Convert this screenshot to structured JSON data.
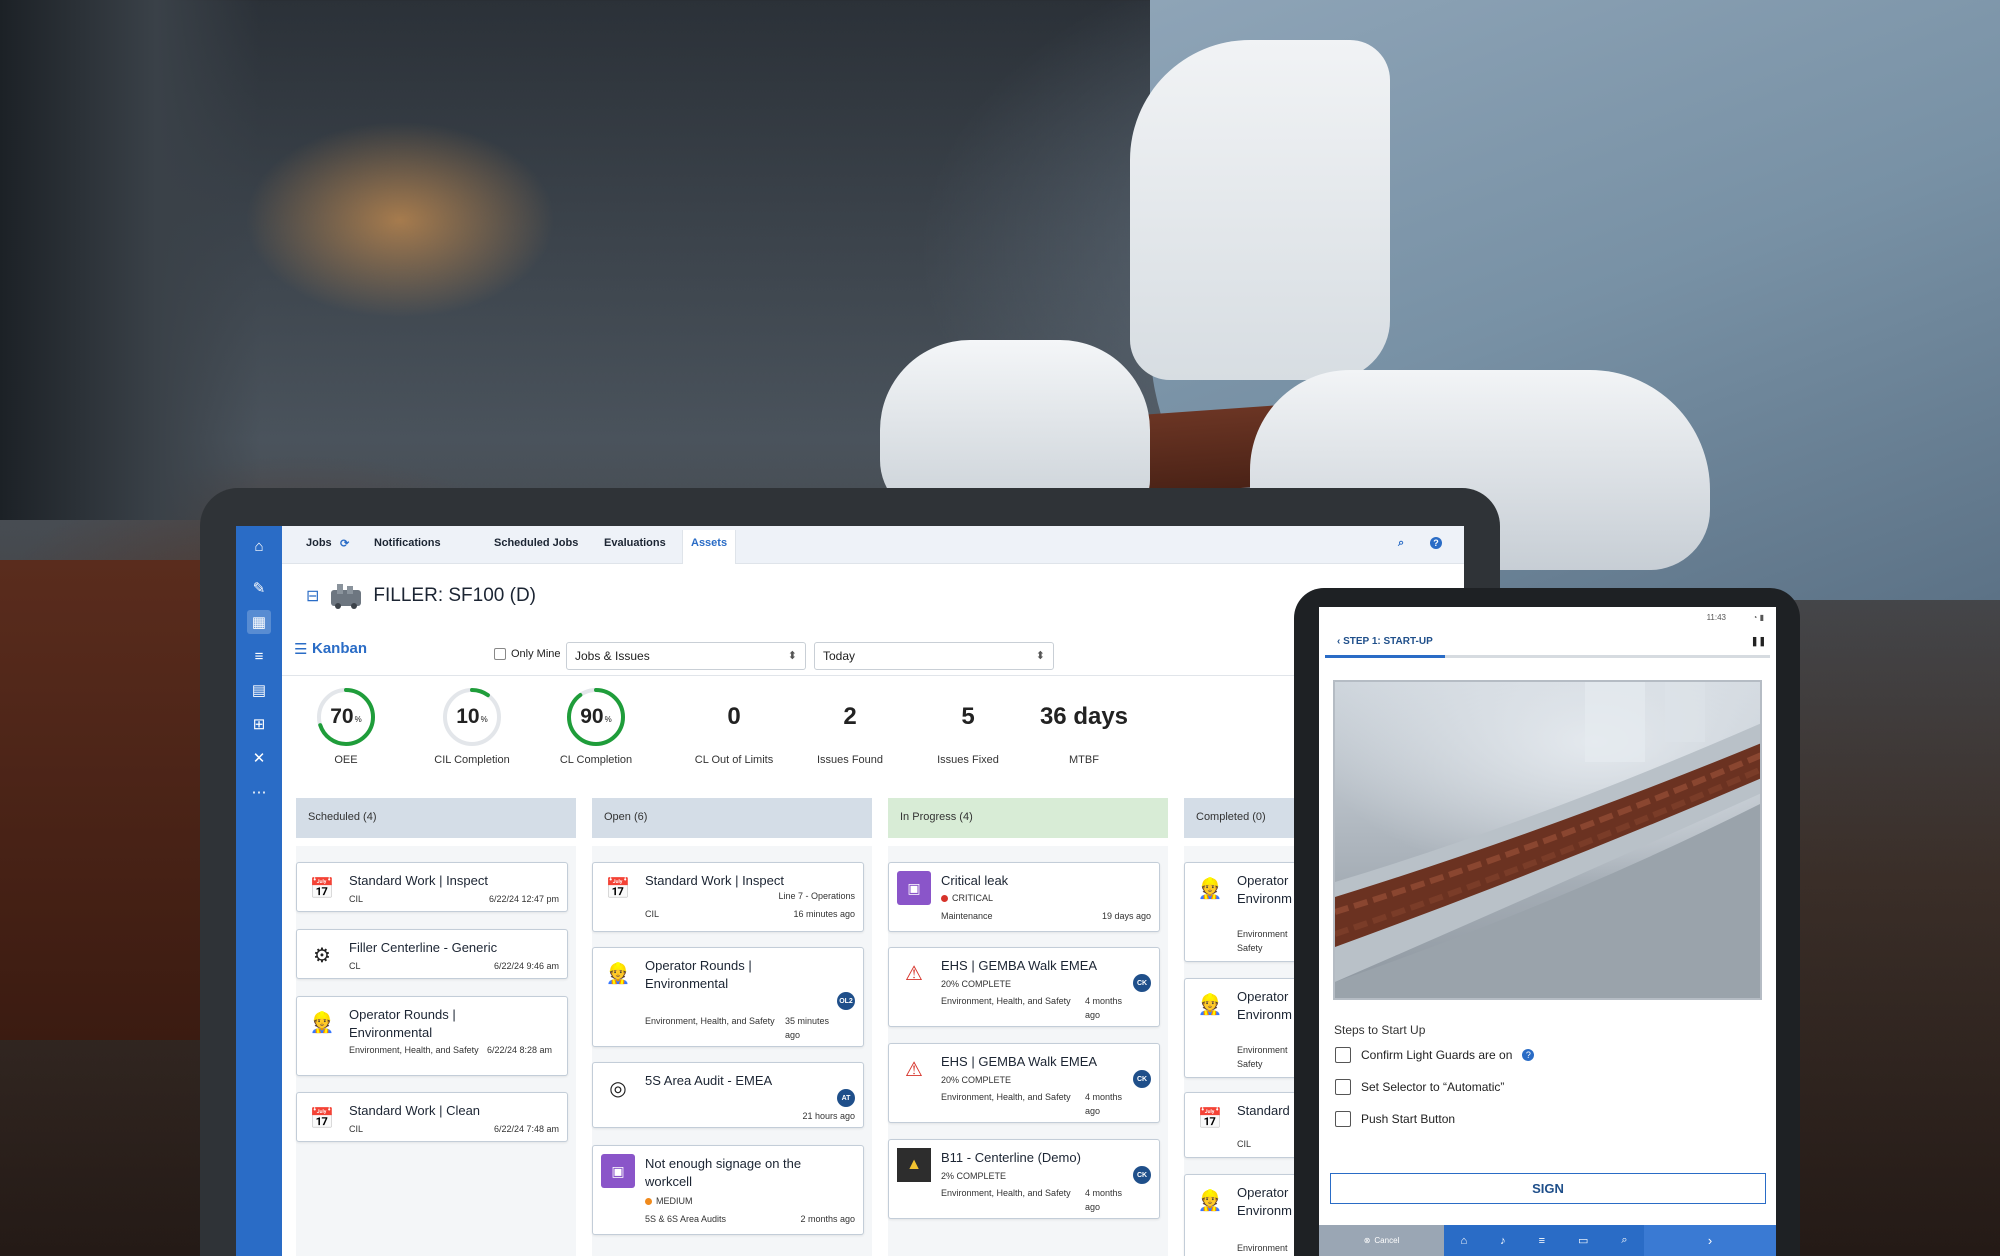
{
  "nav": {
    "tabs": [
      "Jobs",
      "Notifications",
      "Scheduled Jobs",
      "Evaluations",
      "Assets"
    ],
    "active": "Assets"
  },
  "asset": {
    "title": "FILLER: SF100 (D)"
  },
  "kanban": {
    "title": "Kanban",
    "only_mine": "Only Mine",
    "filter_type": "Jobs & Issues",
    "filter_date": "Today"
  },
  "metrics": {
    "oee": {
      "value": "70",
      "unit": "%",
      "label": "OEE",
      "percent": 70,
      "color": "#1f9d3a"
    },
    "cil": {
      "value": "10",
      "unit": "%",
      "label": "CIL Completion",
      "percent": 10,
      "color": "#1f9d3a"
    },
    "cl": {
      "value": "90",
      "unit": "%",
      "label": "CL Completion",
      "percent": 90,
      "color": "#1f9d3a"
    },
    "cl_out": {
      "value": "0",
      "label": "CL Out of Limits"
    },
    "issues_found": {
      "value": "2",
      "label": "Issues Found"
    },
    "issues_fixed": {
      "value": "5",
      "label": "Issues Fixed"
    },
    "mtbf": {
      "value": "36 days",
      "label": "MTBF"
    }
  },
  "columns": {
    "scheduled": {
      "label": "Scheduled (4)",
      "color": "#d4dde7",
      "cards": [
        {
          "title": "Standard Work | Inspect",
          "type": "CIL",
          "time": "6/22/24 12:47 pm"
        },
        {
          "title": "Filler Centerline - Generic",
          "type": "CL",
          "time": "6/22/24 9:46 am"
        },
        {
          "title": "Operator Rounds | Environmental",
          "type": "Environment, Health, and Safety",
          "time": "6/22/24 8:28 am"
        },
        {
          "title": "Standard Work | Clean",
          "type": "CIL",
          "time": "6/22/24 7:48 am"
        }
      ]
    },
    "open": {
      "label": "Open (6)",
      "color": "#d4dde7",
      "cards": [
        {
          "title": "Standard Work | Inspect",
          "location": "Line 7 - Operations",
          "type": "CIL",
          "time": "16 minutes ago"
        },
        {
          "title": "Operator Rounds | Environmental",
          "type": "Environment, Health, and Safety",
          "time": "35 minutes ago",
          "badge": "OL2"
        },
        {
          "title": "5S Area Audit - EMEA",
          "time": "21 hours ago",
          "badge": "AT"
        },
        {
          "title": "Not enough signage on the workcell",
          "severity": "MEDIUM",
          "type": "5S & 6S Area Audits",
          "time": "2 months ago"
        }
      ]
    },
    "progress": {
      "label": "In Progress (4)",
      "color": "#d8ecd6",
      "cards": [
        {
          "title": "Critical leak",
          "severity": "CRITICAL",
          "type": "Maintenance",
          "time": "19 days ago"
        },
        {
          "title": "EHS | GEMBA Walk EMEA",
          "status": "20% COMPLETE",
          "type": "Environment, Health, and Safety",
          "time": "4 months ago",
          "badge": "CK"
        },
        {
          "title": "EHS | GEMBA Walk EMEA",
          "status": "20% COMPLETE",
          "type": "Environment, Health, and Safety",
          "time": "4 months ago",
          "badge": "CK"
        },
        {
          "title": "B11 - Centerline (Demo)",
          "status": "2% COMPLETE",
          "type": "Environment, Health, and Safety",
          "time": "4 months ago",
          "badge": "CK"
        }
      ]
    },
    "completed": {
      "label": "Completed (0)",
      "color": "#d4dde7",
      "cards": [
        {
          "title": "Operator",
          "title2": "Environm",
          "type": "Environment",
          "type2": "Safety"
        },
        {
          "title": "Operator",
          "title2": "Environm",
          "type": "Environment",
          "type2": "Safety"
        },
        {
          "title": "Standard",
          "type": "CIL"
        },
        {
          "title": "Operator",
          "title2": "Environm",
          "type": "Environment"
        }
      ]
    }
  },
  "tablet": {
    "time": "11:43",
    "step": "STEP 1:  START-UP",
    "progress": 0.27,
    "steps_title": "Steps to Start Up",
    "checklist": [
      "Confirm Light Guards are on",
      "Set Selector to “Automatic”",
      "Push Start Button"
    ],
    "sign": "SIGN",
    "cancel": "Cancel"
  }
}
